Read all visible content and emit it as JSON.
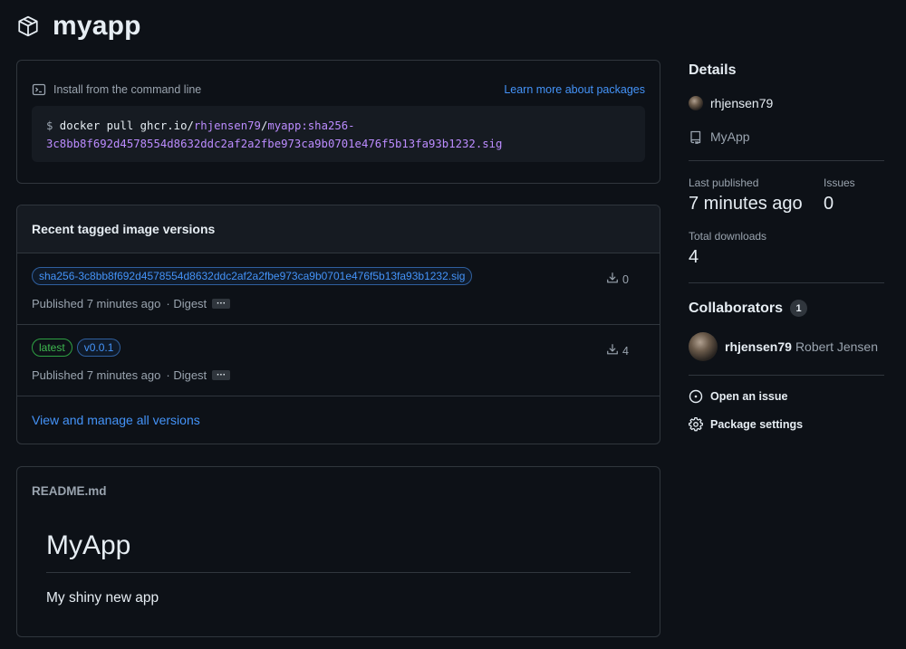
{
  "header": {
    "title": "myapp",
    "icon": "package-icon"
  },
  "install": {
    "label": "Install from the command line",
    "learn_link": "Learn more about packages",
    "command": {
      "prompt": "$",
      "prefix": " docker pull ghcr.io/",
      "owner": "rhjensen79",
      "slash": "/",
      "image_line1": "myapp:sha256-",
      "image_line2": "3c8bb8f692d4578554d8632ddc2af2a2fbe973ca9b0701e476f5b13fa93b1232.sig"
    }
  },
  "versions": {
    "title": "Recent tagged image versions",
    "rows": [
      {
        "tags": [
          "sha256-3c8bb8f692d4578554d8632ddc2af2a2fbe973ca9b0701e476f5b13fa93b1232.sig"
        ],
        "published": "Published 7 minutes ago",
        "digest": "· Digest",
        "downloads": "0"
      },
      {
        "tags": [
          "latest",
          "v0.0.1"
        ],
        "published": "Published 7 minutes ago",
        "digest": "· Digest",
        "downloads": "4"
      }
    ],
    "view_all": "View and manage all versions"
  },
  "readme": {
    "filename": "README.md",
    "title": "MyApp",
    "text": "My shiny new app"
  },
  "sidebar": {
    "details_title": "Details",
    "owner": "rhjensen79",
    "repo": "MyApp",
    "last_published_label": "Last published",
    "last_published_value": "7 minutes ago",
    "issues_label": "Issues",
    "issues_value": "0",
    "downloads_label": "Total downloads",
    "downloads_value": "4",
    "collaborators_title": "Collaborators",
    "collaborators_count": "1",
    "collaborator_username": "rhjensen79",
    "collaborator_name": "Robert Jensen",
    "open_issue": "Open an issue",
    "package_settings": "Package settings"
  },
  "colors": {
    "background": "#0d1117",
    "border": "#30363d",
    "link": "#4493f8",
    "purple": "#bc8cff",
    "green": "#3fb950",
    "muted": "#9aa4af"
  }
}
